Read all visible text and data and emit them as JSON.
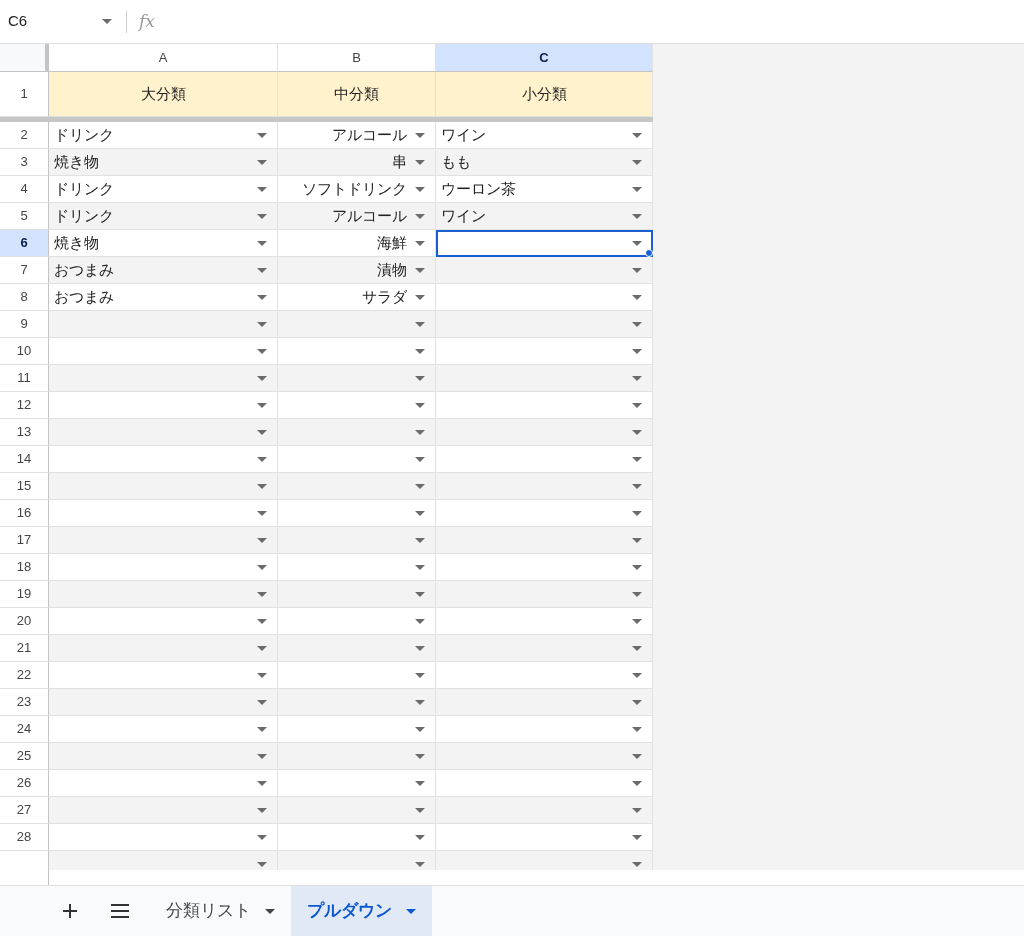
{
  "name_box": {
    "value": "C6"
  },
  "formula_bar": {
    "icon_text": "fx"
  },
  "columns": [
    {
      "label": "A",
      "selected": false,
      "kind": "left"
    },
    {
      "label": "B",
      "selected": false,
      "kind": "right"
    },
    {
      "label": "C",
      "selected": true,
      "kind": "left"
    }
  ],
  "header_row": {
    "number": "1",
    "cells": [
      "大分類",
      "中分類",
      "小分類"
    ]
  },
  "rows": [
    {
      "number": "2",
      "selected": false,
      "cells": [
        "ドリンク",
        "アルコール",
        "ワイン"
      ]
    },
    {
      "number": "3",
      "selected": false,
      "cells": [
        "焼き物",
        "串",
        "もも"
      ]
    },
    {
      "number": "4",
      "selected": false,
      "cells": [
        "ドリンク",
        "ソフトドリンク",
        "ウーロン茶"
      ]
    },
    {
      "number": "5",
      "selected": false,
      "cells": [
        "ドリンク",
        "アルコール",
        "ワイン"
      ]
    },
    {
      "number": "6",
      "selected": true,
      "cells": [
        "焼き物",
        "海鮮",
        null
      ]
    },
    {
      "number": "7",
      "selected": false,
      "cells": [
        "おつまみ",
        "漬物",
        null
      ]
    },
    {
      "number": "8",
      "selected": false,
      "cells": [
        "おつまみ",
        "サラダ",
        null
      ]
    },
    {
      "number": "9",
      "selected": false,
      "cells": [
        null,
        null,
        null
      ]
    },
    {
      "number": "10",
      "selected": false,
      "cells": [
        null,
        null,
        null
      ]
    },
    {
      "number": "11",
      "selected": false,
      "cells": [
        null,
        null,
        null
      ]
    },
    {
      "number": "12",
      "selected": false,
      "cells": [
        null,
        null,
        null
      ]
    },
    {
      "number": "13",
      "selected": false,
      "cells": [
        null,
        null,
        null
      ]
    },
    {
      "number": "14",
      "selected": false,
      "cells": [
        null,
        null,
        null
      ]
    },
    {
      "number": "15",
      "selected": false,
      "cells": [
        null,
        null,
        null
      ]
    },
    {
      "number": "16",
      "selected": false,
      "cells": [
        null,
        null,
        null
      ]
    },
    {
      "number": "17",
      "selected": false,
      "cells": [
        null,
        null,
        null
      ]
    },
    {
      "number": "18",
      "selected": false,
      "cells": [
        null,
        null,
        null
      ]
    },
    {
      "number": "19",
      "selected": false,
      "cells": [
        null,
        null,
        null
      ]
    },
    {
      "number": "20",
      "selected": false,
      "cells": [
        null,
        null,
        null
      ]
    },
    {
      "number": "21",
      "selected": false,
      "cells": [
        null,
        null,
        null
      ]
    },
    {
      "number": "22",
      "selected": false,
      "cells": [
        null,
        null,
        null
      ]
    },
    {
      "number": "23",
      "selected": false,
      "cells": [
        null,
        null,
        null
      ]
    },
    {
      "number": "24",
      "selected": false,
      "cells": [
        null,
        null,
        null
      ]
    },
    {
      "number": "25",
      "selected": false,
      "cells": [
        null,
        null,
        null
      ]
    },
    {
      "number": "26",
      "selected": false,
      "cells": [
        null,
        null,
        null
      ]
    },
    {
      "number": "27",
      "selected": false,
      "cells": [
        null,
        null,
        null
      ]
    },
    {
      "number": "28",
      "selected": false,
      "cells": [
        null,
        null,
        null
      ]
    },
    {
      "selected": false,
      "cells": [
        null,
        null,
        null
      ]
    }
  ],
  "sheet_tabs": [
    {
      "label": "分類リスト",
      "selected": false
    },
    {
      "label": "プルダウン",
      "selected": true
    }
  ]
}
